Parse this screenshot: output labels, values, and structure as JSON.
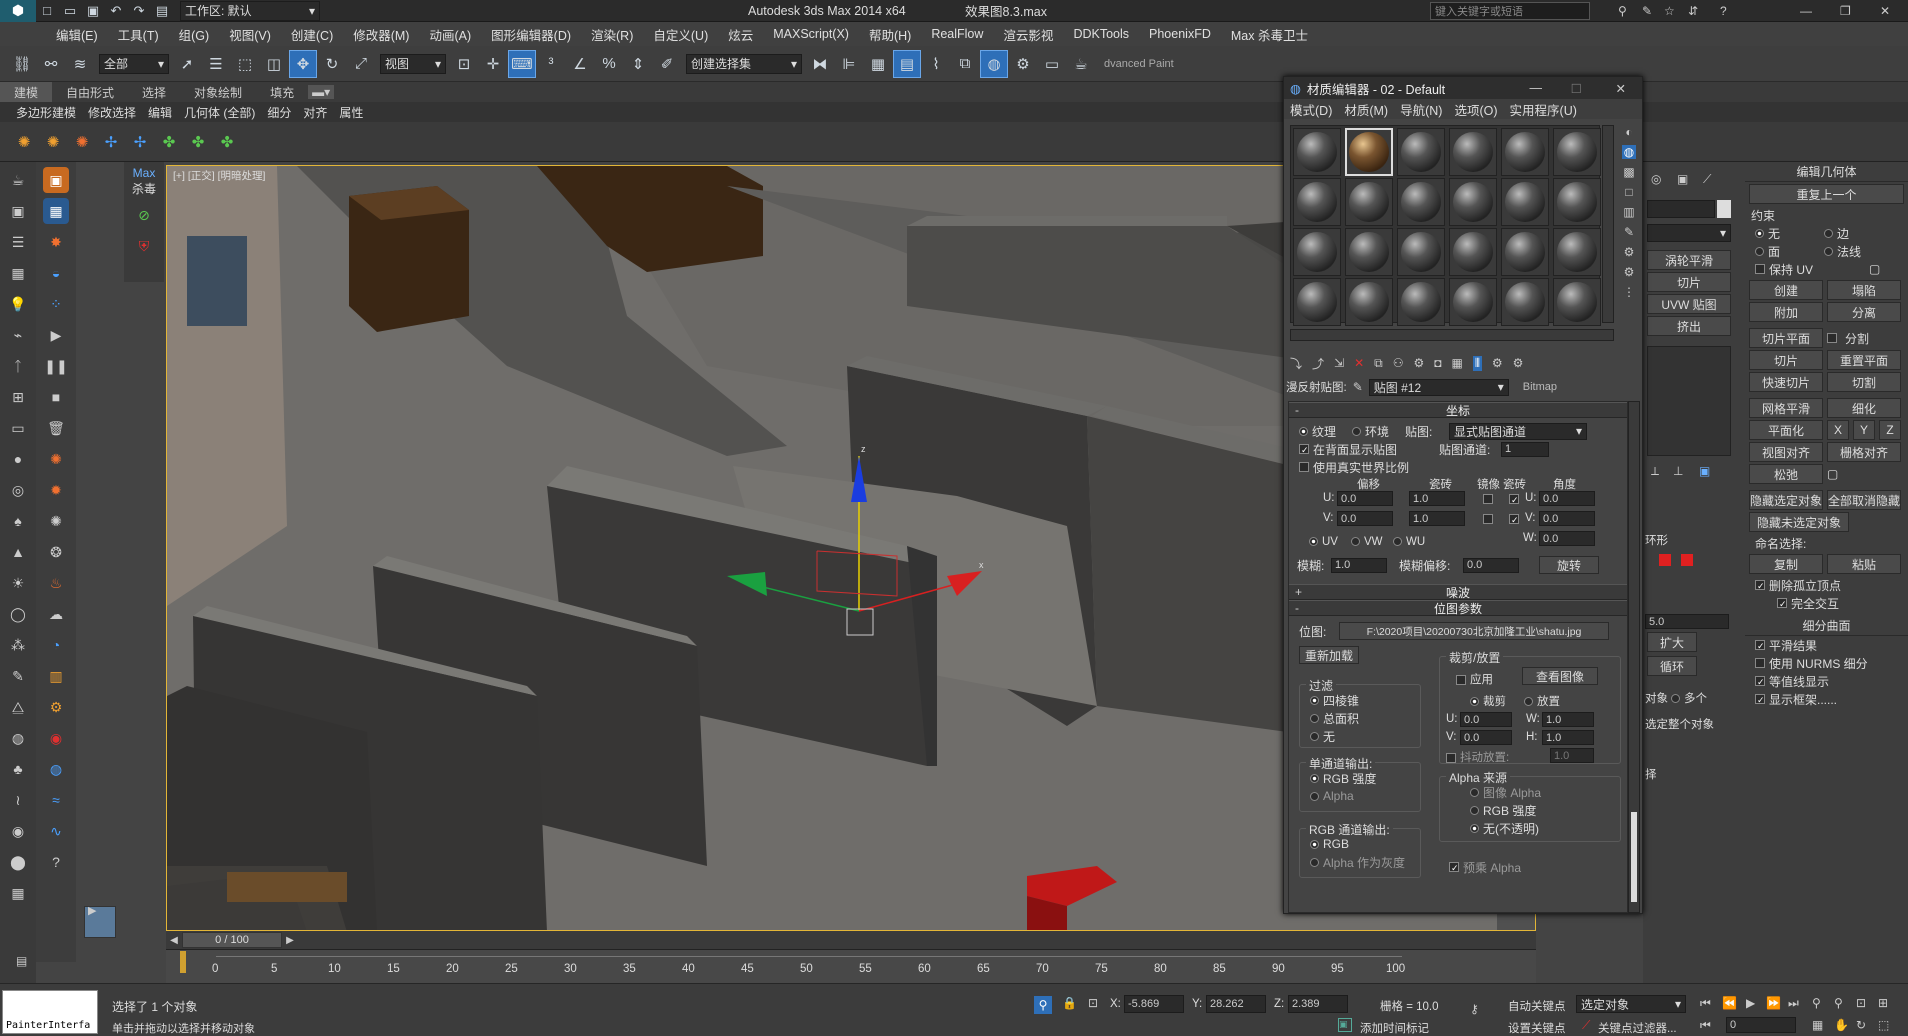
{
  "app": {
    "title": "Autodesk 3ds Max  2014 x64",
    "file": "效果图8.3.max",
    "workspace": "工作区: 默认",
    "search_placeholder": "键入关键字或短语"
  },
  "menu": [
    "编辑(E)",
    "工具(T)",
    "组(G)",
    "视图(V)",
    "创建(C)",
    "修改器(M)",
    "动画(A)",
    "图形编辑器(D)",
    "渲染(R)",
    "自定义(U)",
    "炫云",
    "MAXScript(X)",
    "帮助(H)",
    "RealFlow",
    "渲云影视",
    "DDKTools",
    "PhoenixFD",
    "Max 杀毒卫士"
  ],
  "toolbar": {
    "selection_filter": "全部",
    "ref_coord": "视图",
    "named_sel": "创建选择集",
    "advanced_paint": "dvanced Paint"
  },
  "ribbon_tabs": [
    "建模",
    "自由形式",
    "选择",
    "对象绘制",
    "填充"
  ],
  "ribbon_sub": [
    "多边形建模",
    "修改选择",
    "编辑",
    "几何体 (全部)",
    "细分",
    "对齐",
    "属性"
  ],
  "max_panel": {
    "label1": "Max",
    "label2": "杀毒"
  },
  "viewport": {
    "label": "[+] [正交] [明暗处理]"
  },
  "timeline": {
    "frame": "0 / 100"
  },
  "ruler_ticks": [
    "0",
    "5",
    "10",
    "15",
    "20",
    "25",
    "30",
    "35",
    "40",
    "45",
    "50",
    "55",
    "60",
    "65",
    "70",
    "75",
    "80",
    "85",
    "90",
    "95",
    "100"
  ],
  "status": {
    "msg1": "选择了 1 个对象",
    "msg2": "单击并拖动以选择并移动对象",
    "x": "-5.869",
    "y": "28.262",
    "z": "2.389",
    "grid": "栅格 = 10.0",
    "autokey": "自动关键点",
    "setkey": "设置关键点",
    "sel_obj": "选定对象",
    "key_filter": "关键点过滤器...",
    "add_time_tag": "添加时间标记",
    "frame_field": "0",
    "painter": "PainterInterfa"
  },
  "mat": {
    "title": "材质编辑器 - 02 - Default",
    "menu": [
      "模式(D)",
      "材质(M)",
      "导航(N)",
      "选项(O)",
      "实用程序(U)"
    ],
    "map_label": "漫反射贴图:",
    "map_name": "贴图 #12",
    "map_type": "Bitmap",
    "coord": {
      "title": "坐标",
      "texture": "纹理",
      "environ": "环境",
      "map_label": "贴图:",
      "map_value": "显式贴图通道",
      "show_back": "在背面显示贴图",
      "map_channel": "贴图通道:",
      "map_channel_val": "1",
      "real_world": "使用真实世界比例",
      "offset": "偏移",
      "tiling": "瓷砖",
      "mirror": "镜像",
      "tile": "瓷砖",
      "angle": "角度",
      "u": "U:",
      "v": "V:",
      "w": "W:",
      "u_off": "0.0",
      "v_off": "0.0",
      "u_til": "1.0",
      "v_til": "1.0",
      "u_ang": "0.0",
      "v_ang": "0.0",
      "w_ang": "0.0",
      "uv": "UV",
      "vw": "VW",
      "wu": "WU",
      "blur": "模糊:",
      "blur_val": "1.0",
      "blur_off": "模糊偏移:",
      "blur_off_val": "0.0",
      "rotate": "旋转"
    },
    "noise": "噪波",
    "bitmap": {
      "title": "位图参数",
      "path_label": "位图:",
      "path": "F:\\2020项目\\20200730北京加隆工业\\shatu.jpg",
      "reload": "重新加载",
      "crop": "裁剪/放置",
      "apply": "应用",
      "view": "查看图像",
      "crop_r": "裁剪",
      "place_r": "放置",
      "u": "U:",
      "v": "V:",
      "w": "W:",
      "h": "H:",
      "u_val": "0.0",
      "v_val": "0.0",
      "w_val": "1.0",
      "h_val": "1.0",
      "jitter": "抖动放置:",
      "jitter_val": "1.0",
      "filter": "过滤",
      "pyramid": "四棱锥",
      "sum": "总面积",
      "none": "无",
      "mono": "单通道输出:",
      "rgb_int": "RGB 强度",
      "alpha": "Alpha",
      "rgb_out": "RGB 通道输出:",
      "rgb": "RGB",
      "alpha_gray": "Alpha 作为灰度",
      "alpha_src": "Alpha 来源",
      "img_alpha": "图像 Alpha",
      "rgb_int2": "RGB 强度",
      "opaque": "无(不透明)",
      "premult": "预乘 Alpha"
    }
  },
  "cmd": {
    "edit_geo": "编辑几何体",
    "repeat": "重复上一个",
    "constraint": "约束",
    "none": "无",
    "edge": "边",
    "face": "面",
    "normal": "法线",
    "keep_uv": "保持 UV",
    "create": "创建",
    "collapse": "塌陷",
    "attach": "附加",
    "detach": "分离",
    "slice_plane": "切片平面",
    "split": "分割",
    "slice": "切片",
    "reset_plane": "重置平面",
    "quickslice": "快速切片",
    "cut": "切割",
    "meshsmooth": "网格平滑",
    "tessellate": "细化",
    "planarize": "平面化",
    "view_align": "视图对齐",
    "grid_align": "栅格对齐",
    "relax": "松弛",
    "hide_sel": "隐藏选定对象",
    "unhide_all": "全部取消隐藏",
    "hide_unsel": "隐藏未选定对象",
    "named_sel": "命名选择:",
    "copy": "复制",
    "paste": "粘贴",
    "del_iso": "删除孤立顶点",
    "full_inter": "完全交互",
    "subdiv": "细分曲面",
    "smooth_res": "平滑结果",
    "nurms": "使用 NURMS 细分",
    "iso_disp": "等值线显示",
    "show_cage": "显示框架......",
    "x": "X",
    "y": "Y",
    "z": "Z",
    "turbo": "涡轮平滑",
    "slice2": "切片",
    "uvw": "UVW 贴图",
    "extrude": "挤出",
    "expand": "扩大",
    "loop": "循环",
    "multi": "多个",
    "select_all": "选定整个对象",
    "ring": "环形",
    "spinner": "5.0"
  },
  "colors": {
    "accent": "#2e6fb8",
    "viewport_border": "#e3b637"
  }
}
